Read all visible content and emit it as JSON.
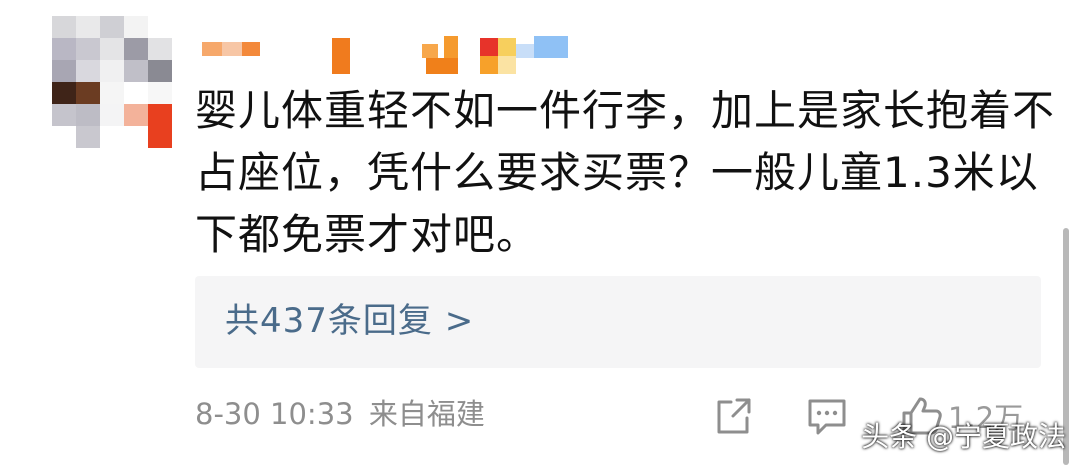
{
  "comment": {
    "text": "婴儿体重轻不如一件行李，加上是家长抱着不占座位，凭什么要求买票？一般儿童1.3米以下都免票才对吧。"
  },
  "replies": {
    "label": "共437条回复 >"
  },
  "meta": {
    "timestamp": "8-30 10:33",
    "location": "来自福建"
  },
  "actions": {
    "share_icon": "share-icon",
    "comment_icon": "comment-icon",
    "like_icon": "thumbs-up-icon",
    "like_count": "1.2万"
  },
  "watermark": {
    "text": "头条 @宁夏政法"
  },
  "colors": {
    "text": "#111111",
    "link": "#4a6b8a",
    "meta": "#8e8e8e",
    "reply_bg": "#f5f5f6"
  }
}
